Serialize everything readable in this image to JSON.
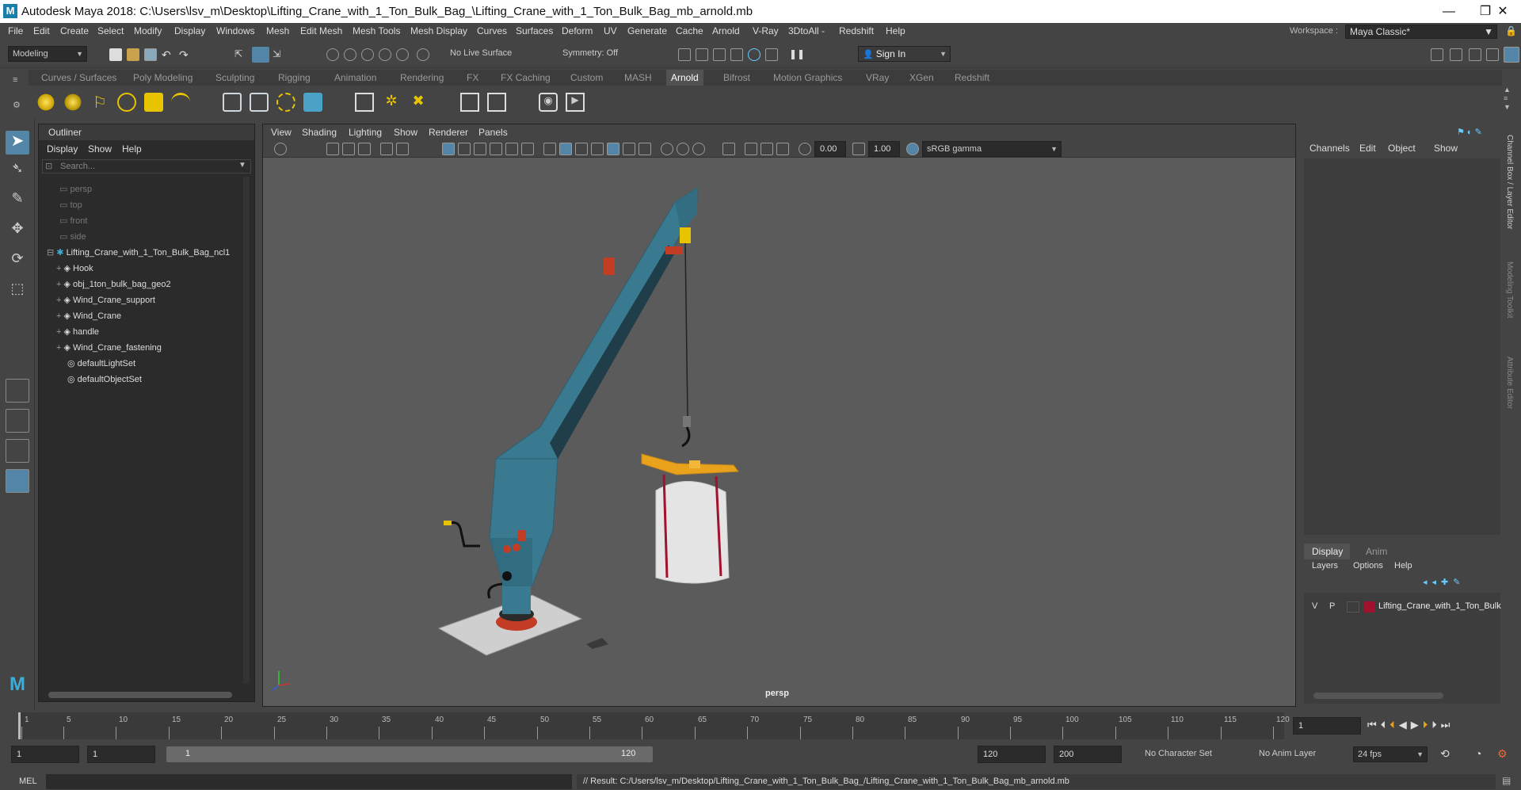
{
  "window": {
    "title": "Autodesk Maya 2018: C:\\Users\\lsv_m\\Desktop\\Lifting_Crane_with_1_Ton_Bulk_Bag_\\Lifting_Crane_with_1_Ton_Bulk_Bag_mb_arnold.mb",
    "logo": "M",
    "minimize": "—",
    "restore": "❐",
    "close": "✕"
  },
  "menu": [
    "File",
    "Edit",
    "Create",
    "Select",
    "Modify",
    "Display",
    "Windows",
    "Mesh",
    "Edit Mesh",
    "Mesh Tools",
    "Mesh Display",
    "Curves",
    "Surfaces",
    "Deform",
    "UV",
    "Generate",
    "Cache",
    "Arnold",
    "V-Ray",
    "3DtoAll -",
    "Redshift",
    "Help"
  ],
  "workspace": {
    "label": "Workspace :",
    "value": "Maya Classic*"
  },
  "status": {
    "mode": "Modeling",
    "live_surface": "No Live Surface",
    "symmetry": "Symmetry: Off",
    "sign_in": "Sign In"
  },
  "shelf_tabs": [
    "Curves / Surfaces",
    "Poly Modeling",
    "Sculpting",
    "Rigging",
    "Animation",
    "Rendering",
    "FX",
    "FX Caching",
    "Custom",
    "MASH",
    "Arnold",
    "Bifrost",
    "Motion Graphics",
    "VRay",
    "XGen",
    "Redshift"
  ],
  "shelf_active": "Arnold",
  "outliner": {
    "title": "Outliner",
    "menu": [
      "Display",
      "Show",
      "Help"
    ],
    "search_placeholder": "Search...",
    "cameras": [
      "persp",
      "top",
      "front",
      "side"
    ],
    "group": "Lifting_Crane_with_1_Ton_Bulk_Bag_ncl1",
    "children": [
      "Hook",
      "obj_1ton_bulk_bag_geo2",
      "Wind_Crane_support",
      "Wind_Crane",
      "handle",
      "Wind_Crane_fastening"
    ],
    "sets": [
      "defaultLightSet",
      "defaultObjectSet"
    ]
  },
  "viewport": {
    "menu": [
      "View",
      "Shading",
      "Lighting",
      "Show",
      "Renderer",
      "Panels"
    ],
    "near_value": "0.00",
    "far_value": "1.00",
    "color_space": "sRGB gamma",
    "camera_label": "persp"
  },
  "channel_box": {
    "menu": [
      "Channels",
      "Edit",
      "Object",
      "Show"
    ],
    "side_tabs": [
      "Channel Box / Layer Editor",
      "Modeling Toolkit",
      "Attribute Editor"
    ]
  },
  "layer_editor": {
    "tabs": [
      "Display",
      "Anim"
    ],
    "menu": [
      "Layers",
      "Options",
      "Help"
    ],
    "layer": {
      "v": "V",
      "p": "P",
      "name": "Lifting_Crane_with_1_Ton_Bulk",
      "color": "#a0122e"
    }
  },
  "timeline": {
    "ticks": [
      "1",
      "5",
      "10",
      "15",
      "20",
      "25",
      "30",
      "35",
      "40",
      "45",
      "50",
      "55",
      "60",
      "65",
      "70",
      "75",
      "80",
      "85",
      "90",
      "95",
      "100",
      "105",
      "110",
      "115",
      "120"
    ],
    "current_frame": "1"
  },
  "range": {
    "start": "1",
    "anim_start": "1",
    "slider_start": "1",
    "slider_end": "120",
    "end": "120",
    "anim_end": "200",
    "character_set": "No Character Set",
    "anim_layer": "No Anim Layer",
    "fps": "24 fps"
  },
  "command_line": {
    "lang": "MEL",
    "result": "// Result: C:/Users/lsv_m/Desktop/Lifting_Crane_with_1_Ton_Bulk_Bag_/Lifting_Crane_with_1_Ton_Bulk_Bag_mb_arnold.mb"
  },
  "colors": {
    "crane": "#3a7a91",
    "shelf_active": "#525252",
    "accent_blue": "#5285a6",
    "bag": "#e4e4e4",
    "spreader": "#e8a21c"
  }
}
